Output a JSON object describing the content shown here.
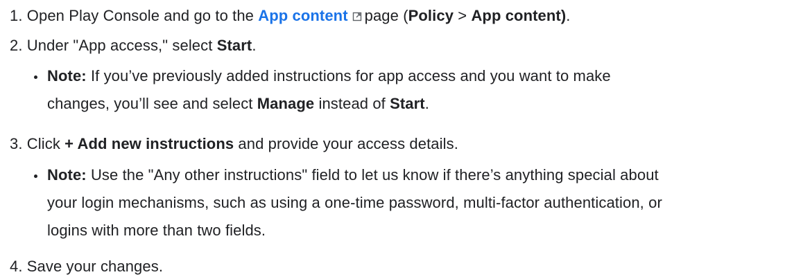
{
  "steps": [
    {
      "num": "1.",
      "pre": "Open Play Console and go to the",
      "link": "App content",
      "mid": "page (",
      "bold1": "Policy",
      "sep": ">",
      "bold2": "App content)",
      "end": "."
    },
    {
      "num": "2.",
      "pre": "Under \"App access,\" select",
      "bold": "Start",
      "end": ".",
      "note": {
        "label": "Note:",
        "line1": "If you’ve previously added instructions for app access and you want to make",
        "line2_pre": "changes, you’ll see and select",
        "bold_a": "Manage",
        "line2_mid": "instead of",
        "bold_b": "Start",
        "line2_end": "."
      }
    },
    {
      "num": "3.",
      "pre": "Click",
      "bold": "+ Add new instructions",
      "end": "and provide your access details.",
      "note": {
        "label": "Note:",
        "line1": "Use the \"Any other instructions\" field to let us know if there’s anything special about",
        "line2": "your login mechanisms, such as using a one-time password, multi-factor authentication, or",
        "line3": "logins with more than two fields."
      }
    },
    {
      "num": "4.",
      "text": "Save your changes."
    }
  ],
  "icons": {
    "external_link": "open-in-new-icon"
  },
  "colors": {
    "text": "#202124",
    "link": "#1a73e8"
  }
}
